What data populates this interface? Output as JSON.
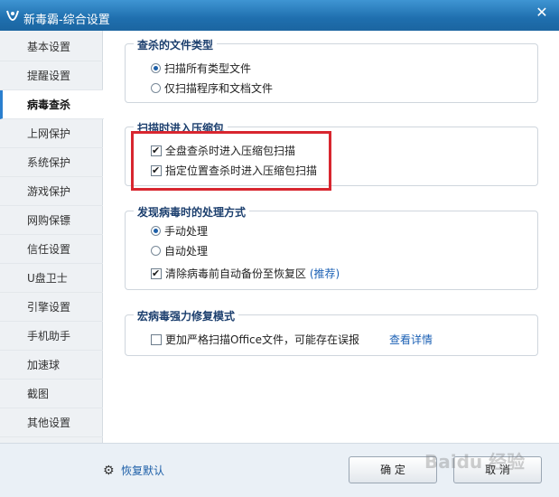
{
  "window": {
    "title": "新毒霸-综合设置",
    "close_glyph": "✕"
  },
  "sidebar": {
    "items": [
      {
        "label": "基本设置",
        "active": false
      },
      {
        "label": "提醒设置",
        "active": false
      },
      {
        "label": "病毒查杀",
        "active": true
      },
      {
        "label": "上网保护",
        "active": false
      },
      {
        "label": "系统保护",
        "active": false
      },
      {
        "label": "游戏保护",
        "active": false
      },
      {
        "label": "网购保镖",
        "active": false
      },
      {
        "label": "信任设置",
        "active": false
      },
      {
        "label": "U盘卫士",
        "active": false
      },
      {
        "label": "引擎设置",
        "active": false
      },
      {
        "label": "手机助手",
        "active": false
      },
      {
        "label": "加速球",
        "active": false
      },
      {
        "label": "截图",
        "active": false
      },
      {
        "label": "其他设置",
        "active": false
      }
    ]
  },
  "groups": {
    "file_types": {
      "title": "查杀的文件类型",
      "options": [
        {
          "label": "扫描所有类型文件",
          "selected": true
        },
        {
          "label": "仅扫描程序和文档文件",
          "selected": false
        }
      ]
    },
    "archives": {
      "title": "扫描时进入压缩包",
      "options": [
        {
          "label": "全盘查杀时进入压缩包扫描",
          "checked": true
        },
        {
          "label": "指定位置查杀时进入压缩包扫描",
          "checked": true
        }
      ]
    },
    "on_virus": {
      "title": "发现病毒时的处理方式",
      "options": [
        {
          "label": "手动处理",
          "selected": true
        },
        {
          "label": "自动处理",
          "selected": false
        }
      ],
      "backup_label": "清除病毒前自动备份至恢复区",
      "backup_hint": "(推荐)",
      "backup_checked": true
    },
    "macro": {
      "title": "宏病毒强力修复模式",
      "option_label": "更加严格扫描Office文件，可能存在误报",
      "option_checked": false,
      "details_link": "查看详情"
    }
  },
  "footer": {
    "restore_label": "恢复默认",
    "ok_label": "确 定",
    "cancel_label": "取 消"
  },
  "watermark": "Baidu 经验",
  "colors": {
    "accent": "#1d5fa8",
    "titlebar": "#2a7bbf",
    "highlight": "#d8262f"
  }
}
